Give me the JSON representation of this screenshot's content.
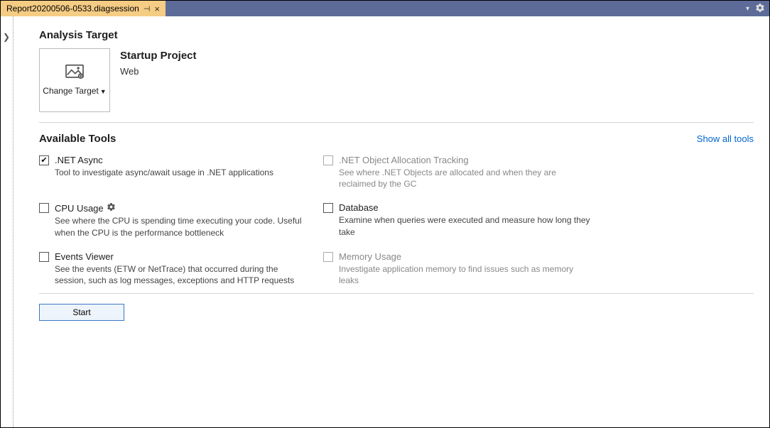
{
  "tab": {
    "title": "Report20200506-0533.diagsession"
  },
  "analysis_target": {
    "heading": "Analysis Target",
    "change_target_label": "Change Target",
    "project_title": "Startup Project",
    "project_sub": "Web"
  },
  "available_tools": {
    "heading": "Available Tools",
    "show_all_label": "Show all tools",
    "tools": [
      {
        "name": ".NET Async",
        "desc": "Tool to investigate async/await usage in .NET applications",
        "checked": true,
        "disabled": false,
        "gear": false
      },
      {
        "name": ".NET Object Allocation Tracking",
        "desc": "See where .NET Objects are allocated and when they are reclaimed by the GC",
        "checked": false,
        "disabled": true,
        "gear": false
      },
      {
        "name": "CPU Usage",
        "desc": "See where the CPU is spending time executing your code. Useful when the CPU is the performance bottleneck",
        "checked": false,
        "disabled": false,
        "gear": true
      },
      {
        "name": "Database",
        "desc": "Examine when queries were executed and measure how long they take",
        "checked": false,
        "disabled": false,
        "gear": false
      },
      {
        "name": "Events Viewer",
        "desc": "See the events (ETW or NetTrace) that occurred during the session, such as log messages, exceptions and HTTP requests",
        "checked": false,
        "disabled": false,
        "gear": false
      },
      {
        "name": "Memory Usage",
        "desc": "Investigate application memory to find issues such as memory leaks",
        "checked": false,
        "disabled": true,
        "gear": false
      }
    ]
  },
  "start_button": "Start"
}
